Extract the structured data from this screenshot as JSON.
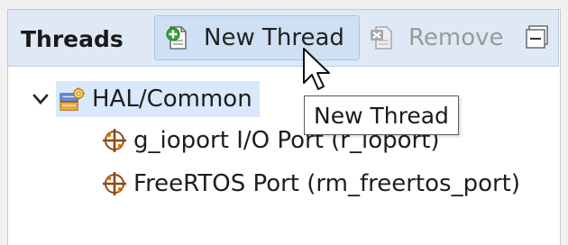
{
  "panel": {
    "title": "Threads"
  },
  "toolbar": {
    "new_thread_label": "New Thread",
    "remove_label": "Remove"
  },
  "tree": {
    "root": {
      "label": "HAL/Common",
      "expanded": true
    },
    "children": [
      {
        "label": "g_ioport I/O Port (r_ioport)"
      },
      {
        "label": "FreeRTOS Port (rm_freertos_port)"
      }
    ]
  },
  "tooltip": {
    "text": "New Thread"
  },
  "colors": {
    "toolbar_bg": "#dfe9f6",
    "selection_bg": "#d9e8fa",
    "button_hover_bg": "#cfe0f4",
    "disabled_text": "#9a9a9a"
  },
  "icons": {
    "new_thread": "add-document-icon",
    "remove": "remove-document-icon",
    "collapse": "collapse-all-icon",
    "root": "hal-common-icon",
    "child": "module-icon",
    "expand": "chevron-down-icon"
  }
}
